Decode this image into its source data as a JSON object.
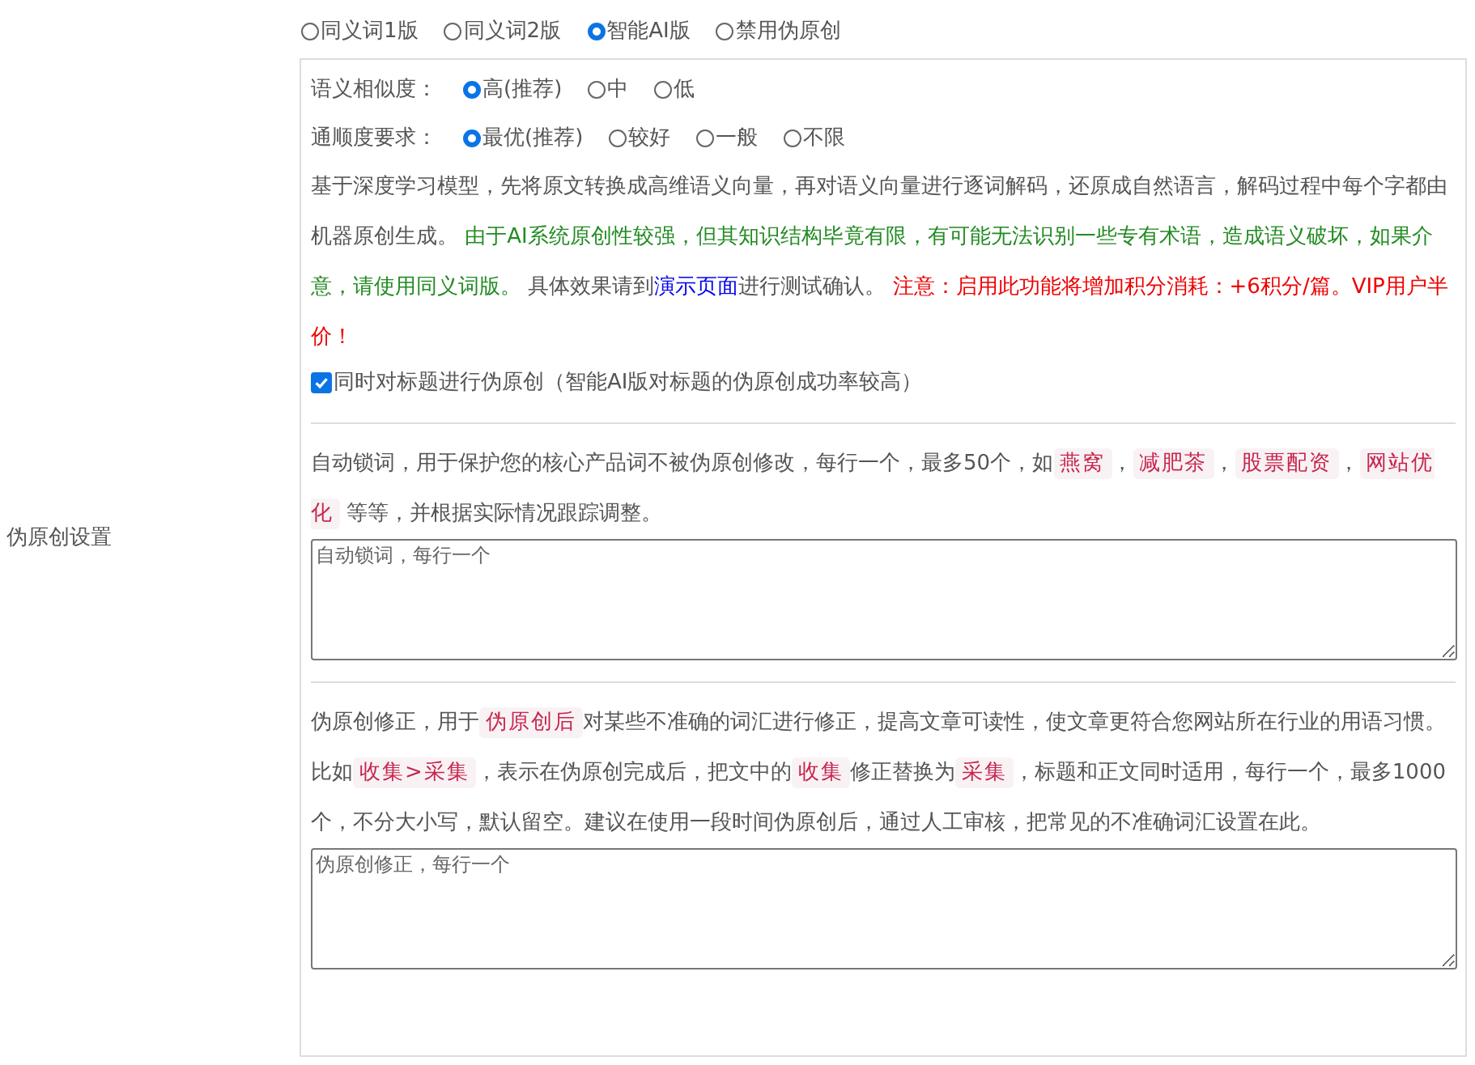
{
  "section_label": "伪原创设置",
  "modes": [
    {
      "label": "同义词1版",
      "selected": false
    },
    {
      "label": "同义词2版",
      "selected": false
    },
    {
      "label": "智能AI版",
      "selected": true
    },
    {
      "label": "禁用伪原创",
      "selected": false
    }
  ],
  "similarity": {
    "label": "语义相似度：",
    "options": [
      {
        "label": "高(推荐)",
        "selected": true
      },
      {
        "label": "中",
        "selected": false
      },
      {
        "label": "低",
        "selected": false
      }
    ]
  },
  "fluency": {
    "label": "通顺度要求：",
    "options": [
      {
        "label": "最优(推荐)",
        "selected": true
      },
      {
        "label": "较好",
        "selected": false
      },
      {
        "label": "一般",
        "selected": false
      },
      {
        "label": "不限",
        "selected": false
      }
    ]
  },
  "ai_description": [
    {
      "kind": "plain",
      "text": "基于深度学习模型，先将原文转换成高维语义向量，再对语义向量进行逐词解码，还原成自然语言，解码过程中每个字都由机器原创生成。 "
    },
    {
      "kind": "green",
      "text": "由于AI系统原创性较强，但其知识结构毕竟有限，有可能无法识别一些专有术语，造成语义破坏，如果介意，请使用同义词版。"
    },
    {
      "kind": "plain",
      "text": " 具体效果请到"
    },
    {
      "kind": "link",
      "text": "演示页面"
    },
    {
      "kind": "plain",
      "text": "进行测试确认。 "
    },
    {
      "kind": "red",
      "text": "注意：启用此功能将增加积分消耗：+6积分/篇。VIP用户半价！"
    }
  ],
  "title_option": {
    "label": "同时对标题进行伪原创（智能AI版对标题的伪原创成功率较高）",
    "checked": true
  },
  "lock_words": {
    "description": [
      {
        "kind": "plain",
        "text": "自动锁词，用于保护您的核心产品词不被伪原创修改，每行一个，最多50个，如"
      },
      {
        "kind": "tag",
        "text": "燕窝"
      },
      {
        "kind": "plain",
        "text": "，"
      },
      {
        "kind": "tag",
        "text": "减肥茶"
      },
      {
        "kind": "plain",
        "text": "，"
      },
      {
        "kind": "tag",
        "text": "股票配资"
      },
      {
        "kind": "plain",
        "text": "，"
      },
      {
        "kind": "tag",
        "text": "网站优化"
      },
      {
        "kind": "plain",
        "text": " 等等，并根据实际情况跟踪调整。"
      }
    ],
    "placeholder": "自动锁词，每行一个"
  },
  "corrections": {
    "description": [
      {
        "kind": "plain",
        "text": "伪原创修正，用于"
      },
      {
        "kind": "tag",
        "text": "伪原创后"
      },
      {
        "kind": "plain",
        "text": "对某些不准确的词汇进行修正，提高文章可读性，使文章更符合您网站所在行业的用语习惯。比如"
      },
      {
        "kind": "tag",
        "text": "收集>采集"
      },
      {
        "kind": "plain",
        "text": "，表示在伪原创完成后，把文中的"
      },
      {
        "kind": "tag",
        "text": "收集"
      },
      {
        "kind": "plain",
        "text": "修正替换为"
      },
      {
        "kind": "tag",
        "text": "采集"
      },
      {
        "kind": "plain",
        "text": "，标题和正文同时适用，每行一个，最多1000个，不分大小写，默认留空。建议在使用一段时间伪原创后，通过人工审核，把常见的不准确词汇设置在此。"
      }
    ],
    "placeholder": "伪原创修正，每行一个"
  }
}
